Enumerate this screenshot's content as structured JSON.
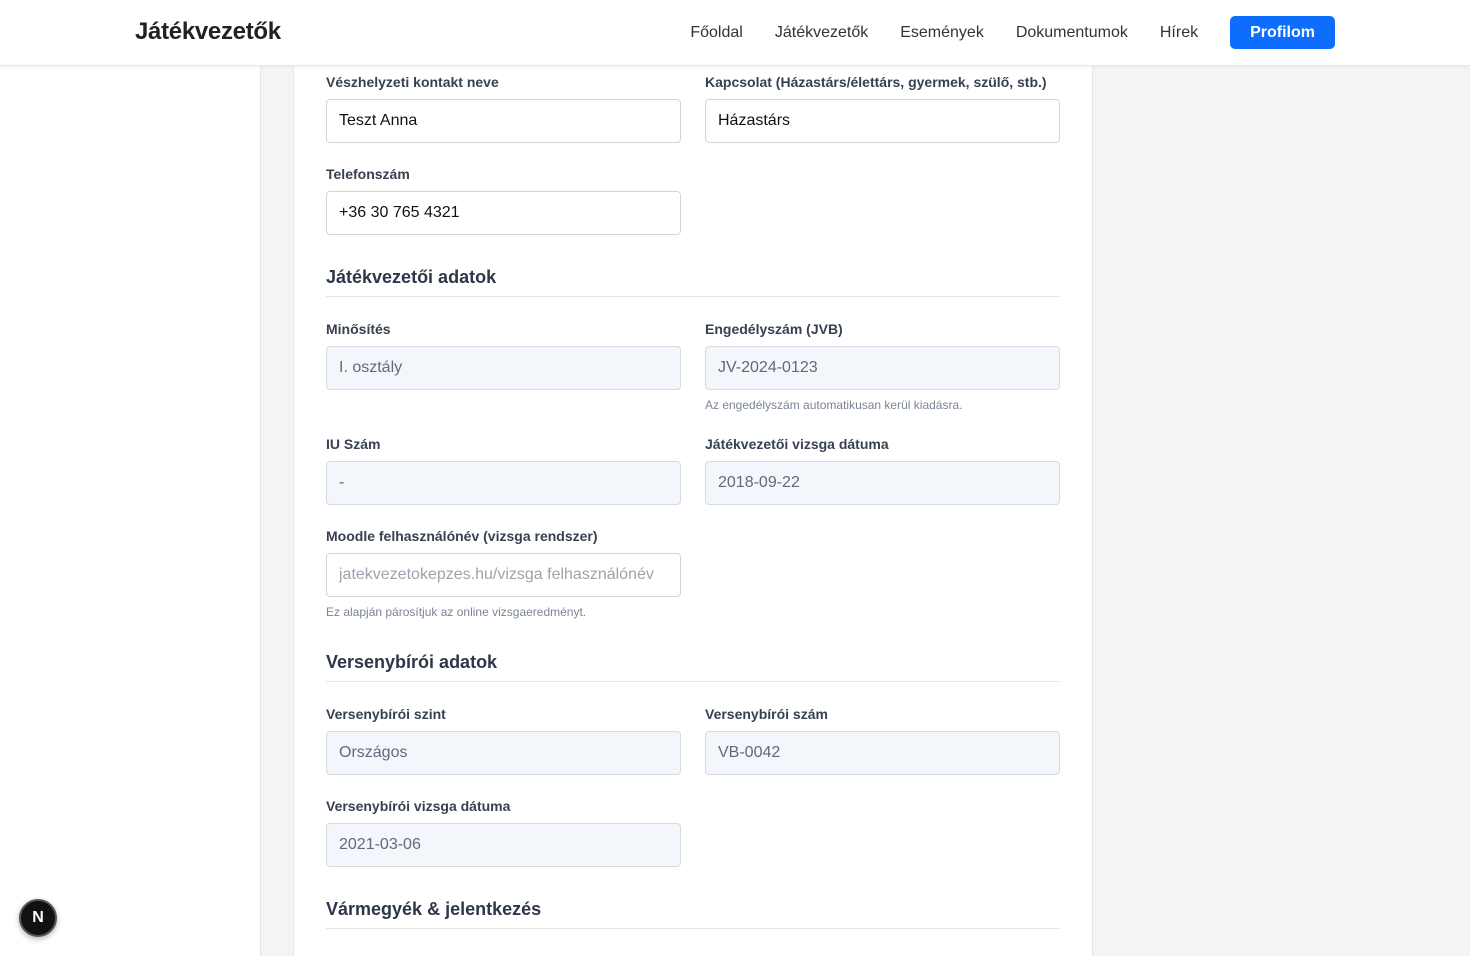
{
  "header": {
    "brand": "Játékvezetők",
    "nav": [
      "Főoldal",
      "Játékvezetők",
      "Események",
      "Dokumentumok",
      "Hírek"
    ],
    "profile_button": "Profilom",
    "accent_color": "#0d6efd"
  },
  "emergency": {
    "contact_name_label": "Vészhelyzeti kontakt neve",
    "contact_name_value": "Teszt Anna",
    "relation_label": "Kapcsolat (Házastárs/élettárs, gyermek, szülő, stb.)",
    "relation_value": "Házastárs",
    "phone_label": "Telefonszám",
    "phone_value": "+36 30 765 4321"
  },
  "referee": {
    "section_title": "Játékvezetői adatok",
    "rating_label": "Minősítés",
    "rating_value": "I. osztály",
    "license_label": "Engedélyszám (JVB)",
    "license_value": "JV-2024-0123",
    "license_help": "Az engedélyszám automatikusan kerül kiadásra.",
    "iu_label": "IU Szám",
    "iu_value": "-",
    "exam_date_label": "Játékvezetői vizsga dátuma",
    "exam_date_value": "2018-09-22",
    "moodle_label": "Moodle felhasználónév (vizsga rendszer)",
    "moodle_placeholder": "jatekvezetokepzes.hu/vizsga felhasználónév",
    "moodle_help": "Ez alapján párosítjuk az online vizsgaeredményt."
  },
  "competition": {
    "section_title": "Versenybírói adatok",
    "level_label": "Versenybírói szint",
    "level_value": "Országos",
    "number_label": "Versenybírói szám",
    "number_value": "VB-0042",
    "exam_date_label": "Versenybírói vizsga dátuma",
    "exam_date_value": "2021-03-06"
  },
  "counties": {
    "section_title": "Vármegyék & jelentkezés"
  },
  "fab": {
    "label": "N"
  }
}
